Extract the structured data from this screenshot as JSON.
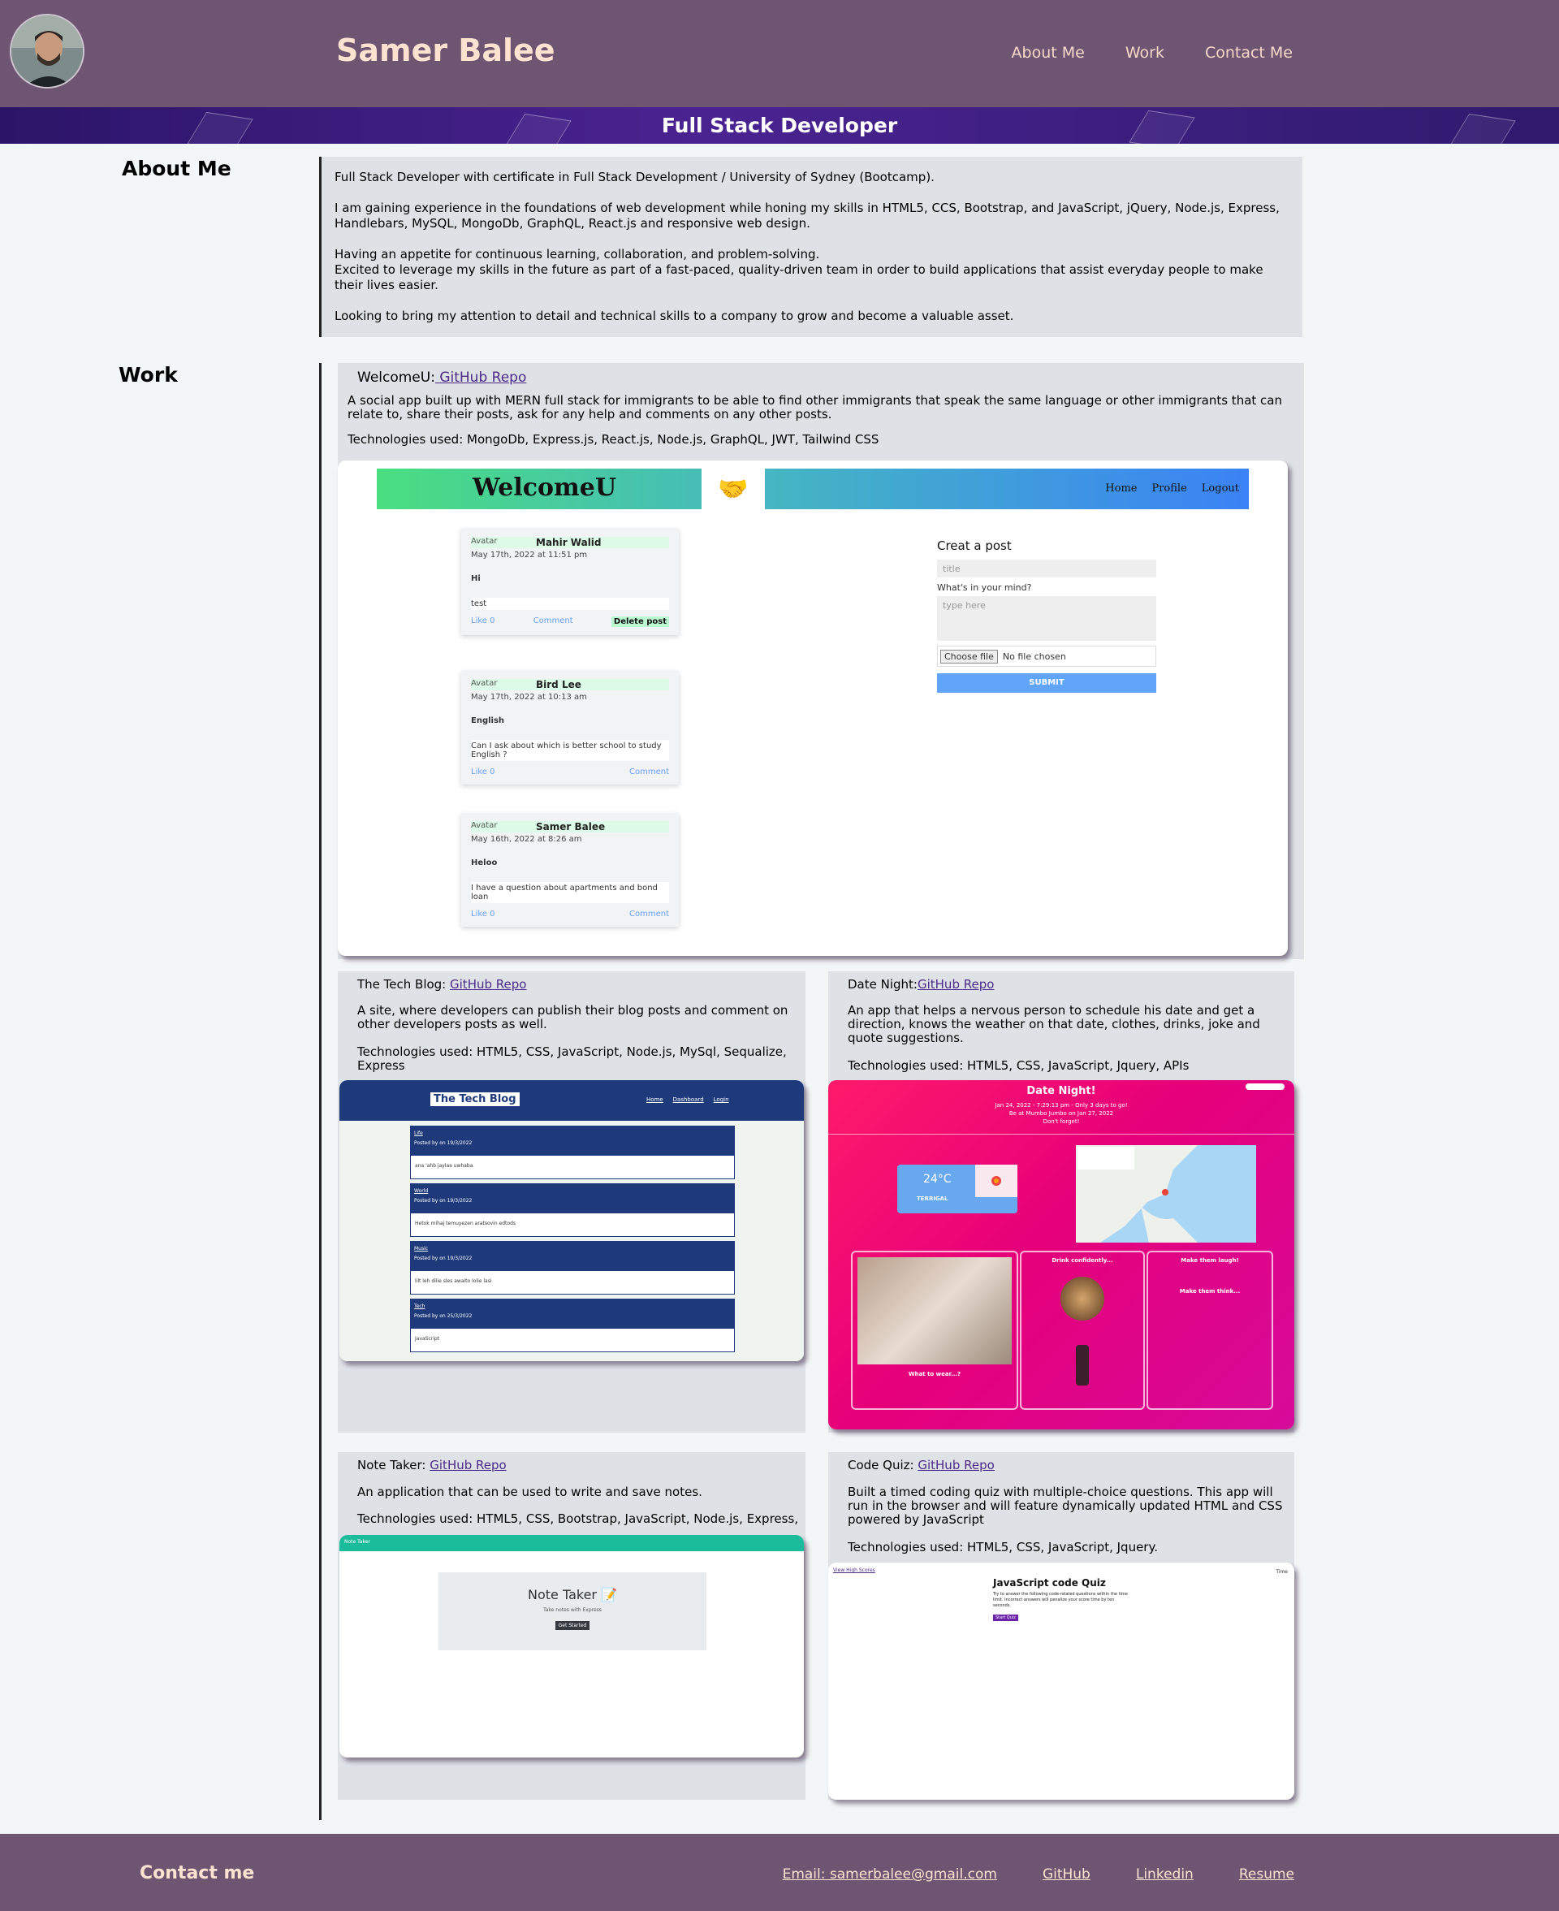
{
  "header": {
    "name": "Samer Balee",
    "nav": [
      "About Me",
      "Work",
      "Contact Me"
    ],
    "banner": "Full Stack Developer"
  },
  "about": {
    "heading": "About Me",
    "paragraphs": [
      "Full Stack Developer with certificate in Full Stack Development / University of Sydney (Bootcamp).",
      "I am gaining experience in the foundations of web development while honing my skills in HTML5, CCS, Bootstrap, and JavaScript, jQuery, Node.js, Express, Handlebars, MySQL, MongoDb, GraphQL, React.js and responsive web design.",
      "Having an appetite for continuous learning, collaboration, and problem-solving.",
      "Excited to leverage my skills in the future as part of a fast-paced, quality-driven team in order to build applications that assist everyday people to make their lives easier.",
      "Looking to bring my attention to detail and technical skills to a company to grow and become a valuable asset."
    ]
  },
  "work": {
    "heading": "Work",
    "projects": [
      {
        "title": "WelcomeU:",
        "link": " GitHub Repo",
        "desc": "A social app built up with MERN full stack for immigrants to be able to find other immigrants that speak the same language or other immigrants that can relate to, share their posts, ask for any help and comments on any other posts.",
        "tech": "Technologies used: MongoDb, Express.js, React.js, Node.js, GraphQL, JWT, Tailwind CSS"
      },
      {
        "title": "The Tech Blog: ",
        "link": "GitHub Repo",
        "desc": "A site, where developers can publish their blog posts and comment on other developers posts as well.",
        "tech": "Technologies used: HTML5, CSS, JavaScript, Node.js, MySql, Sequalize, Express"
      },
      {
        "title": "Date Night:",
        "link": "GitHub Repo",
        "desc": "An app that helps a nervous person to schedule his date and get a direction, knows the weather on that date, clothes, drinks, joke and quote suggestions.",
        "tech": "Technologies used: HTML5, CSS, JavaScript, Jquery, APIs"
      },
      {
        "title": "Note Taker: ",
        "link": "GitHub Repo",
        "desc": "An application that can be used to write and save notes.",
        "tech": "Technologies used: HTML5, CSS, Bootstrap, JavaScript, Node.js, Express,"
      },
      {
        "title": "Code Quiz: ",
        "link": "GitHub Repo",
        "desc": "Built a timed coding quiz with multiple-choice questions. This app will run in the browser and will feature dynamically updated HTML and CSS powered by JavaScript",
        "tech": "Technologies used: HTML5, CSS, JavaScript, Jquery."
      }
    ]
  },
  "screens": {
    "welcomeu": {
      "brand": "WelcomeU",
      "nav": [
        "Home",
        "Profile",
        "Logout"
      ],
      "posts": [
        {
          "alt": "Avatar",
          "name": "Mahir Walid",
          "date": "May 17th, 2022 at 11:51 pm",
          "subject": "Hi",
          "body": "test",
          "like": "Like 0",
          "comment": "Comment",
          "delete": "Delete post"
        },
        {
          "alt": "Avatar",
          "name": "Bird Lee",
          "date": "May 17th, 2022 at 10:13 am",
          "subject": "English",
          "body": "Can I ask about which is better school to study English ?",
          "like": "Like 0",
          "comment": "Comment"
        },
        {
          "alt": "Avatar",
          "name": "Samer Balee",
          "date": "May 16th, 2022 at 8:26 am",
          "subject": "Heloo",
          "body": "I have a question about apartments and bond loan",
          "like": "Like 0",
          "comment": "Comment"
        }
      ],
      "create": {
        "heading": "Creat a post",
        "title_placeholder": "title",
        "label": "What's in your mind?",
        "body_placeholder": "type here",
        "file_button": "Choose file",
        "file_status": "No file chosen",
        "submit": "SUBMIT"
      }
    },
    "techblog": {
      "brand": "The Tech Blog",
      "nav": [
        "Home",
        "Dashboard",
        "Login"
      ],
      "posts": [
        {
          "title": "Life",
          "meta": "Posted by on 19/3/2022",
          "body": "ana 'ahb jaylaa uwhaba"
        },
        {
          "title": "World",
          "meta": "Posted by on 19/3/2022",
          "body": "Hetok mihaj temuyezen aratsovin edtods"
        },
        {
          "title": "Music",
          "meta": "Posted by on 19/3/2022",
          "body": "lilt leh dilie sles awaito lolie lasi"
        },
        {
          "title": "Tech",
          "meta": "Posted by on 25/3/2022",
          "body": "JavaScript"
        }
      ]
    },
    "datenight": {
      "title": "Date Night!",
      "lines": [
        "Jan 24, 2022 - 7:29:13 pm - Only 3 days to go!",
        "Be at Mumbo Jumbo on Jan 27, 2022",
        "Don't forget!"
      ],
      "temp": "24°C",
      "place": "TERRIGAL",
      "panels": [
        "What to wear...?",
        "Drink confidently...",
        "Make them laugh!"
      ],
      "panel_subs": [
        "Make them think..."
      ]
    },
    "notetaker": {
      "bar": "Note Taker",
      "title": "Note Taker",
      "subtitle": "Take notes with Express",
      "button": "Get Started"
    },
    "codequiz": {
      "link": "View High Scores",
      "time": "Time",
      "title": "JavaScript code Quiz",
      "text": "Try to answer the following code-related questions within the time limit. Incorrect answers will penalize your score time by ten seconds.",
      "button": "Start Quiz"
    }
  },
  "footer": {
    "title": "Contact me",
    "links": [
      "Email: samerbalee@gmail.com",
      "GitHub",
      "Linkedin",
      "Resume"
    ]
  },
  "colors": {
    "header_bg": "#6e5572",
    "banner_bg": "#3a1d7c",
    "card_bg": "#dee2e6",
    "accent_text": "#fde3cf"
  }
}
